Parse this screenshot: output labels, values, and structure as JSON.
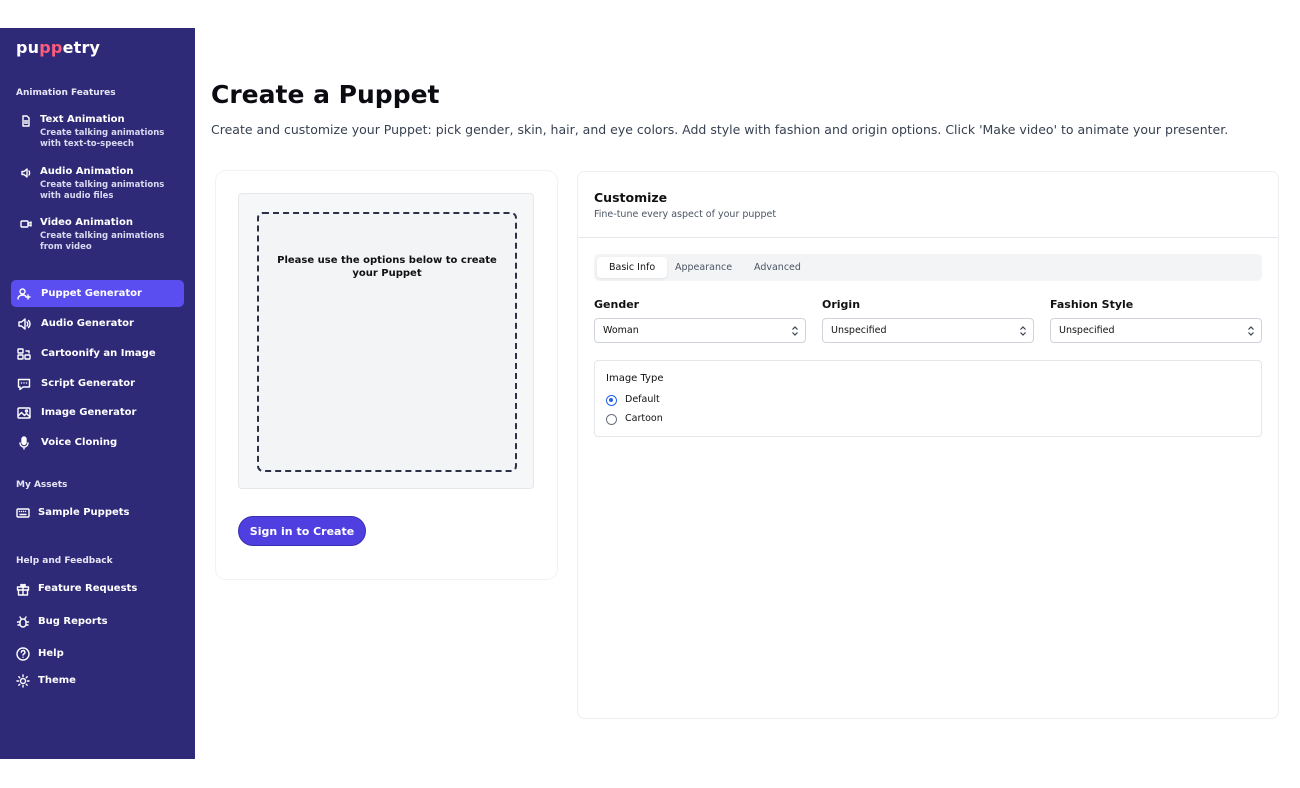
{
  "brand": {
    "logo_prefix": "pu",
    "logo_mid": "pp",
    "logo_suffix": "etry"
  },
  "sidebar": {
    "animation_features_label": "Animation Features",
    "features": [
      {
        "title": "Text Animation",
        "desc": "Create talking animations with text-to-speech",
        "icon": "document-icon"
      },
      {
        "title": "Audio Animation",
        "desc": "Create talking animations with audio files",
        "icon": "speaker-icon"
      },
      {
        "title": "Video Animation",
        "desc": "Create talking animations from video",
        "icon": "video-icon"
      }
    ],
    "tools": [
      {
        "label": "Puppet Generator",
        "icon": "user-plus-icon",
        "active": true
      },
      {
        "label": "Audio Generator",
        "icon": "speaker-icon"
      },
      {
        "label": "Cartoonify an Image",
        "icon": "image-swap-icon"
      },
      {
        "label": "Script Generator",
        "icon": "chat-icon"
      },
      {
        "label": "Image Generator",
        "icon": "image-icon"
      },
      {
        "label": "Voice Cloning",
        "icon": "microphone-icon"
      }
    ],
    "my_assets_label": "My Assets",
    "assets": [
      {
        "label": "Sample Puppets",
        "icon": "keyboard-icon"
      }
    ],
    "help_label": "Help and Feedback",
    "help_items": [
      {
        "label": "Feature Requests",
        "icon": "gift-icon"
      },
      {
        "label": "Bug Reports",
        "icon": "bug-icon"
      },
      {
        "label": "Help",
        "icon": "question-icon"
      },
      {
        "label": "Theme",
        "icon": "sun-icon"
      }
    ],
    "colors": {
      "background": "#2f2a78",
      "active": "#5b4ef0"
    }
  },
  "main": {
    "title": "Create a Puppet",
    "description": "Create and customize your Puppet: pick gender, skin, hair, and eye colors. Add style with fashion and origin options. Click 'Make video' to animate your presenter.",
    "preview": {
      "placeholder": "Please use the options below to create your Puppet",
      "sign_in_button": "Sign in to Create"
    },
    "customize": {
      "title": "Customize",
      "subtitle": "Fine-tune every aspect of your puppet",
      "tabs": [
        {
          "label": "Basic Info",
          "active": true
        },
        {
          "label": "Appearance"
        },
        {
          "label": "Advanced"
        }
      ],
      "fields": [
        {
          "label": "Gender",
          "value": "Woman"
        },
        {
          "label": "Origin",
          "value": "Unspecified"
        },
        {
          "label": "Fashion Style",
          "value": "Unspecified"
        }
      ],
      "image_type": {
        "label": "Image Type",
        "options": [
          {
            "label": "Default",
            "checked": true
          },
          {
            "label": "Cartoon",
            "checked": false
          }
        ]
      }
    }
  }
}
